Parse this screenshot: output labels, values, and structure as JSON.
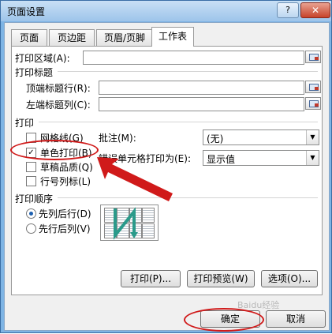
{
  "window": {
    "title": "页面设置",
    "help_glyph": "?",
    "close_glyph": "✕"
  },
  "tabs": [
    {
      "label": "页面"
    },
    {
      "label": "页边距"
    },
    {
      "label": "页眉/页脚"
    },
    {
      "label": "工作表",
      "active": true
    }
  ],
  "print_area": {
    "label": "打印区域(A):",
    "value": ""
  },
  "print_titles": {
    "heading": "打印标题",
    "rows_label": "顶端标题行(R):",
    "rows_value": "",
    "cols_label": "左端标题列(C):",
    "cols_value": ""
  },
  "print": {
    "heading": "打印",
    "gridlines": {
      "label": "网格线(G)",
      "checked": false
    },
    "black_white": {
      "label": "单色打印(B)",
      "checked": true
    },
    "draft": {
      "label": "草稿品质(Q)",
      "checked": false
    },
    "headings": {
      "label": "行号列标(L)",
      "checked": false
    },
    "comments_label": "批注(M):",
    "comments_value": "(无)",
    "errors_label": "错误单元格打印为(E):",
    "errors_value": "显示值"
  },
  "page_order": {
    "heading": "打印顺序",
    "down_then_over": {
      "label": "先列后行(D)",
      "selected": true
    },
    "over_then_down": {
      "label": "先行后列(V)",
      "selected": false
    }
  },
  "panel_buttons": {
    "print": "打印(P)...",
    "preview": "打印预览(W)",
    "options": "选项(O)..."
  },
  "footer_buttons": {
    "ok": "确定",
    "cancel": "取消"
  },
  "watermark": "Baidu经验",
  "colors": {
    "annotation_red": "#d01a1a",
    "arrow_fill": "#d01a1a",
    "order_arrow": "#2a9a8a"
  }
}
